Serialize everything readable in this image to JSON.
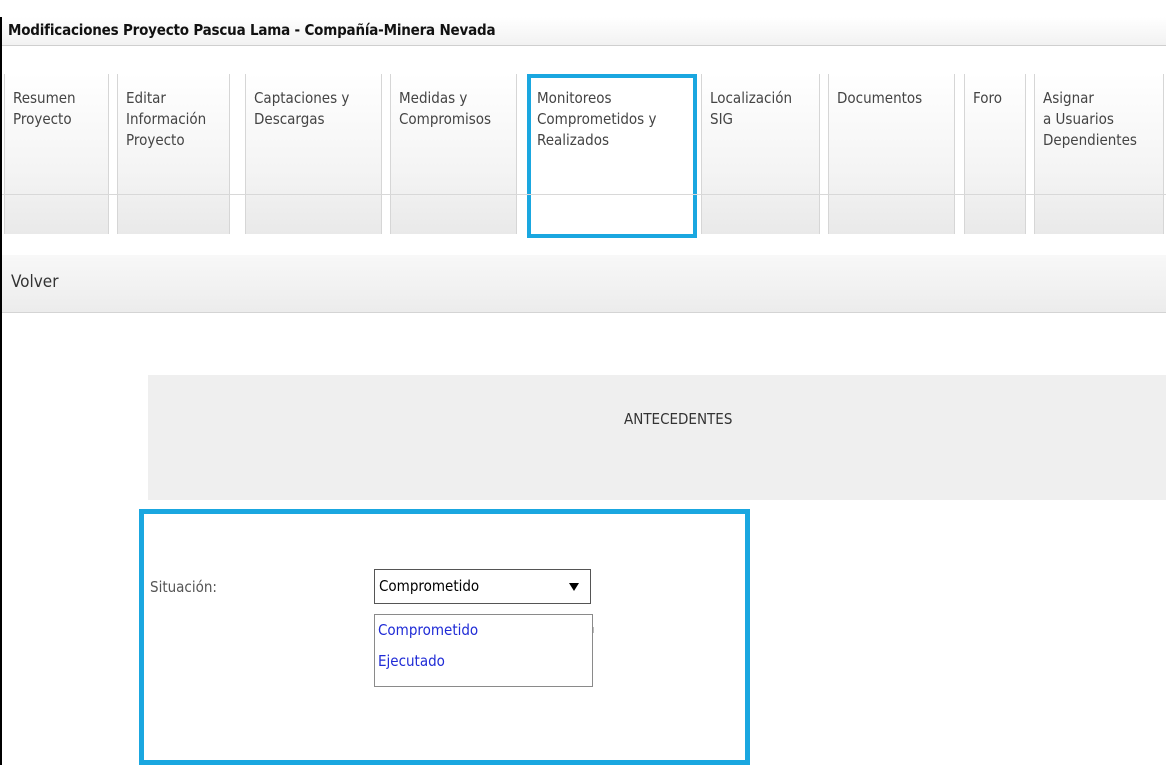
{
  "title": "Modificaciones Proyecto Pascua Lama - Compañía-Minera Nevada",
  "tabs": [
    {
      "label": "Resumen\nProyecto"
    },
    {
      "label": "Editar\nInformación\nProyecto"
    },
    {
      "label": "Captaciones y\nDescargas"
    },
    {
      "label": "Medidas y\nCompromisos"
    },
    {
      "label": "Monitoreos\nComprometidos y\nRealizados",
      "active": true
    },
    {
      "label": "Localización\nSIG"
    },
    {
      "label": "Documentos"
    },
    {
      "label": "Foro"
    },
    {
      "label": "Asignar\na Usuarios\nDependientes"
    }
  ],
  "volver": "Volver",
  "antecedentes": "ANTECEDENTES",
  "situacion": {
    "label": "Situación:",
    "selected": "Comprometido",
    "options": [
      "Comprometido",
      "Ejecutado"
    ]
  },
  "colors": {
    "highlight": "#1aa7e0",
    "option_link": "#1f2bd6"
  }
}
